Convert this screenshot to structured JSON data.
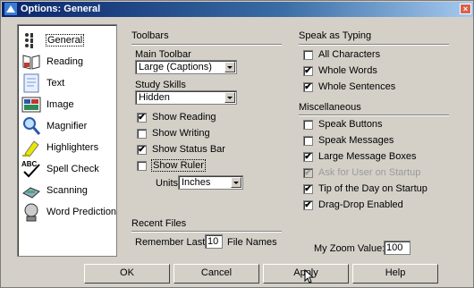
{
  "window": {
    "title": "Options: General",
    "close": "×"
  },
  "sidebar": {
    "items": [
      {
        "label": "General",
        "icon": "general-icon"
      },
      {
        "label": "Reading",
        "icon": "reading-icon"
      },
      {
        "label": "Text",
        "icon": "text-icon"
      },
      {
        "label": "Image",
        "icon": "image-icon"
      },
      {
        "label": "Magnifier",
        "icon": "magnifier-icon"
      },
      {
        "label": "Highlighters",
        "icon": "highlighter-icon"
      },
      {
        "label": "Spell Check",
        "icon": "spell-check-icon"
      },
      {
        "label": "Scanning",
        "icon": "scanner-icon"
      },
      {
        "label": "Word Prediction",
        "icon": "word-prediction-icon"
      }
    ],
    "selected": "General"
  },
  "toolbars": {
    "title": "Toolbars",
    "main_toolbar_label": "Main Toolbar",
    "main_toolbar_value": "Large (Captions)",
    "study_skills_label": "Study Skills",
    "study_skills_value": "Hidden",
    "show_reading": {
      "label": "Show Reading",
      "checked": true
    },
    "show_writing": {
      "label": "Show Writing",
      "checked": false
    },
    "show_status_bar": {
      "label": "Show Status Bar",
      "checked": true
    },
    "show_ruler": {
      "label": "Show Ruler",
      "checked": false
    },
    "units_label": "Units",
    "units_value": "Inches"
  },
  "speak_as_typing": {
    "title": "Speak as Typing",
    "all_characters": {
      "label": "All Characters",
      "checked": false
    },
    "whole_words": {
      "label": "Whole Words",
      "checked": true
    },
    "whole_sentences": {
      "label": "Whole Sentences",
      "checked": true
    }
  },
  "miscellaneous": {
    "title": "Miscellaneous",
    "speak_buttons": {
      "label": "Speak Buttons",
      "checked": false
    },
    "speak_messages": {
      "label": "Speak Messages",
      "checked": false
    },
    "large_message_boxes": {
      "label": "Large Message Boxes",
      "checked": true
    },
    "ask_for_user": {
      "label": "Ask for User on Startup",
      "checked": true,
      "disabled": true
    },
    "tip_of_the_day": {
      "label": "Tip of the Day on Startup",
      "checked": true
    },
    "drag_drop": {
      "label": "Drag-Drop Enabled",
      "checked": true
    }
  },
  "recent_files": {
    "title": "Recent Files",
    "remember_last_label": "Remember Last",
    "count": "10",
    "file_names_label": "File Names"
  },
  "zoom": {
    "label": "My Zoom Value:",
    "value": "100"
  },
  "buttons": {
    "ok": "OK",
    "cancel": "Cancel",
    "apply": "Apply",
    "help": "Help"
  },
  "check_mark": "✔"
}
